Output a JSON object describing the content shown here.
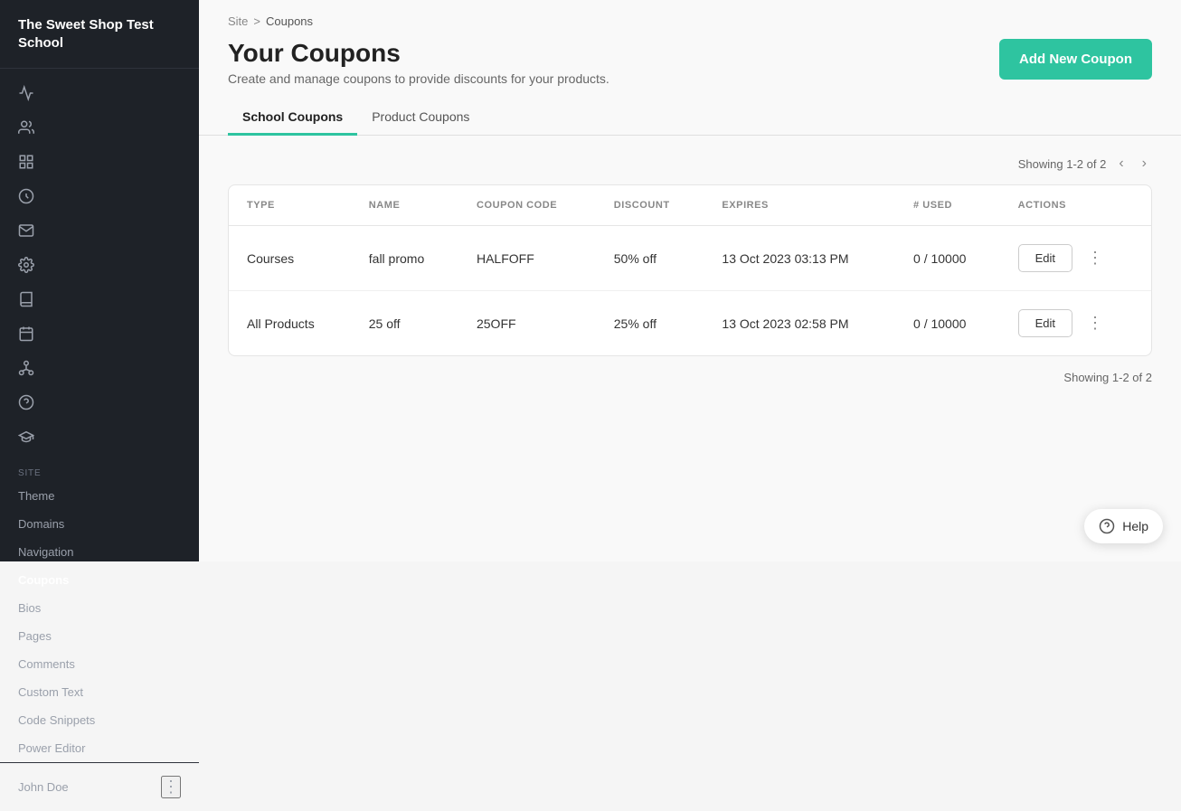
{
  "sidebar": {
    "logo": "The Sweet Shop Test School",
    "section_label": "SITE",
    "nav_items": [
      {
        "id": "theme",
        "label": "Theme"
      },
      {
        "id": "domains",
        "label": "Domains"
      },
      {
        "id": "navigation",
        "label": "Navigation"
      },
      {
        "id": "coupons",
        "label": "Coupons",
        "active": true
      },
      {
        "id": "bios",
        "label": "Bios"
      },
      {
        "id": "pages",
        "label": "Pages"
      },
      {
        "id": "comments",
        "label": "Comments"
      },
      {
        "id": "custom-text",
        "label": "Custom Text"
      },
      {
        "id": "code-snippets",
        "label": "Code Snippets"
      },
      {
        "id": "power-editor",
        "label": "Power Editor"
      }
    ],
    "user": "John Doe"
  },
  "breadcrumb": {
    "site": "Site",
    "separator": ">",
    "current": "Coupons"
  },
  "page": {
    "title": "Your Coupons",
    "subtitle": "Create and manage coupons to provide discounts for your products.",
    "add_button": "Add New Coupon"
  },
  "tabs": [
    {
      "id": "school-coupons",
      "label": "School Coupons",
      "active": true
    },
    {
      "id": "product-coupons",
      "label": "Product Coupons",
      "active": false
    }
  ],
  "pagination": {
    "label": "Showing 1-2 of 2",
    "label_bottom": "Showing 1-2 of 2"
  },
  "table": {
    "columns": [
      "TYPE",
      "NAME",
      "COUPON CODE",
      "DISCOUNT",
      "EXPIRES",
      "# USED",
      "ACTIONS"
    ],
    "rows": [
      {
        "type": "Courses",
        "name": "fall promo",
        "coupon_code": "HALFOFF",
        "discount": "50% off",
        "expires": "13 Oct 2023 03:13 PM",
        "used": "0 / 10000",
        "action": "Edit"
      },
      {
        "type": "All Products",
        "name": "25 off",
        "coupon_code": "25OFF",
        "discount": "25% off",
        "expires": "13 Oct 2023 02:58 PM",
        "used": "0 / 10000",
        "action": "Edit"
      }
    ]
  },
  "help": {
    "label": "Help"
  }
}
